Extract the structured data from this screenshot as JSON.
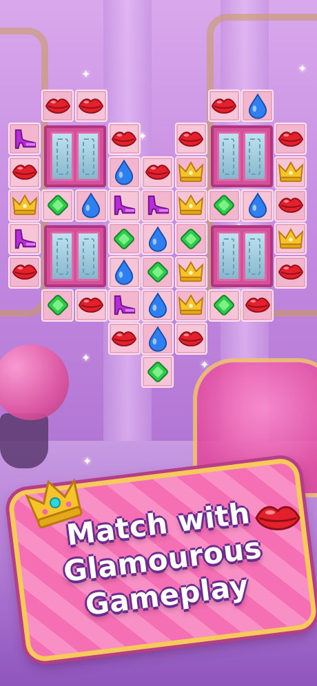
{
  "banner": {
    "line1": "Match with",
    "line2": "Glamourous",
    "line3": "Gameplay"
  },
  "colors": {
    "lips": "#e3202c",
    "crown": "#f5c32a",
    "drop": "#2f7ff0",
    "diamond": "#2fcc4a",
    "heel": "#b62cd6",
    "tile": "#f7c5d8"
  },
  "board": {
    "pieces": [
      {
        "r": 0,
        "c": 1,
        "t": "lips"
      },
      {
        "r": 0,
        "c": 2,
        "t": "lips"
      },
      {
        "r": 0,
        "c": 6,
        "t": "lips"
      },
      {
        "r": 0,
        "c": 7,
        "t": "drop"
      },
      {
        "r": 1,
        "c": 0,
        "t": "heel"
      },
      {
        "r": 1,
        "c": 3,
        "t": "lips"
      },
      {
        "r": 1,
        "c": 5,
        "t": "lips"
      },
      {
        "r": 1,
        "c": 8,
        "t": "lips"
      },
      {
        "r": 2,
        "c": 0,
        "t": "lips"
      },
      {
        "r": 2,
        "c": 3,
        "t": "drop"
      },
      {
        "r": 2,
        "c": 4,
        "t": "lips"
      },
      {
        "r": 2,
        "c": 5,
        "t": "crown"
      },
      {
        "r": 2,
        "c": 8,
        "t": "crown"
      },
      {
        "r": 3,
        "c": 0,
        "t": "crown"
      },
      {
        "r": 3,
        "c": 1,
        "t": "diamond"
      },
      {
        "r": 3,
        "c": 2,
        "t": "drop"
      },
      {
        "r": 3,
        "c": 3,
        "t": "heel"
      },
      {
        "r": 3,
        "c": 4,
        "t": "heel"
      },
      {
        "r": 3,
        "c": 5,
        "t": "crown"
      },
      {
        "r": 3,
        "c": 6,
        "t": "diamond"
      },
      {
        "r": 3,
        "c": 7,
        "t": "drop"
      },
      {
        "r": 3,
        "c": 8,
        "t": "lips"
      },
      {
        "r": 4,
        "c": 0,
        "t": "heel"
      },
      {
        "r": 4,
        "c": 3,
        "t": "diamond"
      },
      {
        "r": 4,
        "c": 4,
        "t": "drop"
      },
      {
        "r": 4,
        "c": 5,
        "t": "diamond"
      },
      {
        "r": 4,
        "c": 8,
        "t": "crown"
      },
      {
        "r": 5,
        "c": 0,
        "t": "lips"
      },
      {
        "r": 5,
        "c": 3,
        "t": "drop"
      },
      {
        "r": 5,
        "c": 4,
        "t": "diamond"
      },
      {
        "r": 5,
        "c": 5,
        "t": "crown"
      },
      {
        "r": 5,
        "c": 8,
        "t": "lips"
      },
      {
        "r": 6,
        "c": 1,
        "t": "diamond"
      },
      {
        "r": 6,
        "c": 2,
        "t": "lips"
      },
      {
        "r": 6,
        "c": 3,
        "t": "heel"
      },
      {
        "r": 6,
        "c": 4,
        "t": "drop"
      },
      {
        "r": 6,
        "c": 5,
        "t": "crown"
      },
      {
        "r": 6,
        "c": 6,
        "t": "diamond"
      },
      {
        "r": 6,
        "c": 7,
        "t": "lips"
      },
      {
        "r": 7,
        "c": 3,
        "t": "lips"
      },
      {
        "r": 7,
        "c": 4,
        "t": "drop"
      },
      {
        "r": 7,
        "c": 5,
        "t": "lips"
      },
      {
        "r": 8,
        "c": 4,
        "t": "diamond"
      }
    ],
    "doors": [
      {
        "r": 1,
        "c": 1
      },
      {
        "r": 1,
        "c": 6
      },
      {
        "r": 4,
        "c": 1
      },
      {
        "r": 4,
        "c": 6
      }
    ]
  },
  "icons": [
    "crown-icon",
    "lips-icon",
    "drop-icon",
    "diamond-icon",
    "heel-icon",
    "door-icon",
    "sparkle-icon"
  ]
}
